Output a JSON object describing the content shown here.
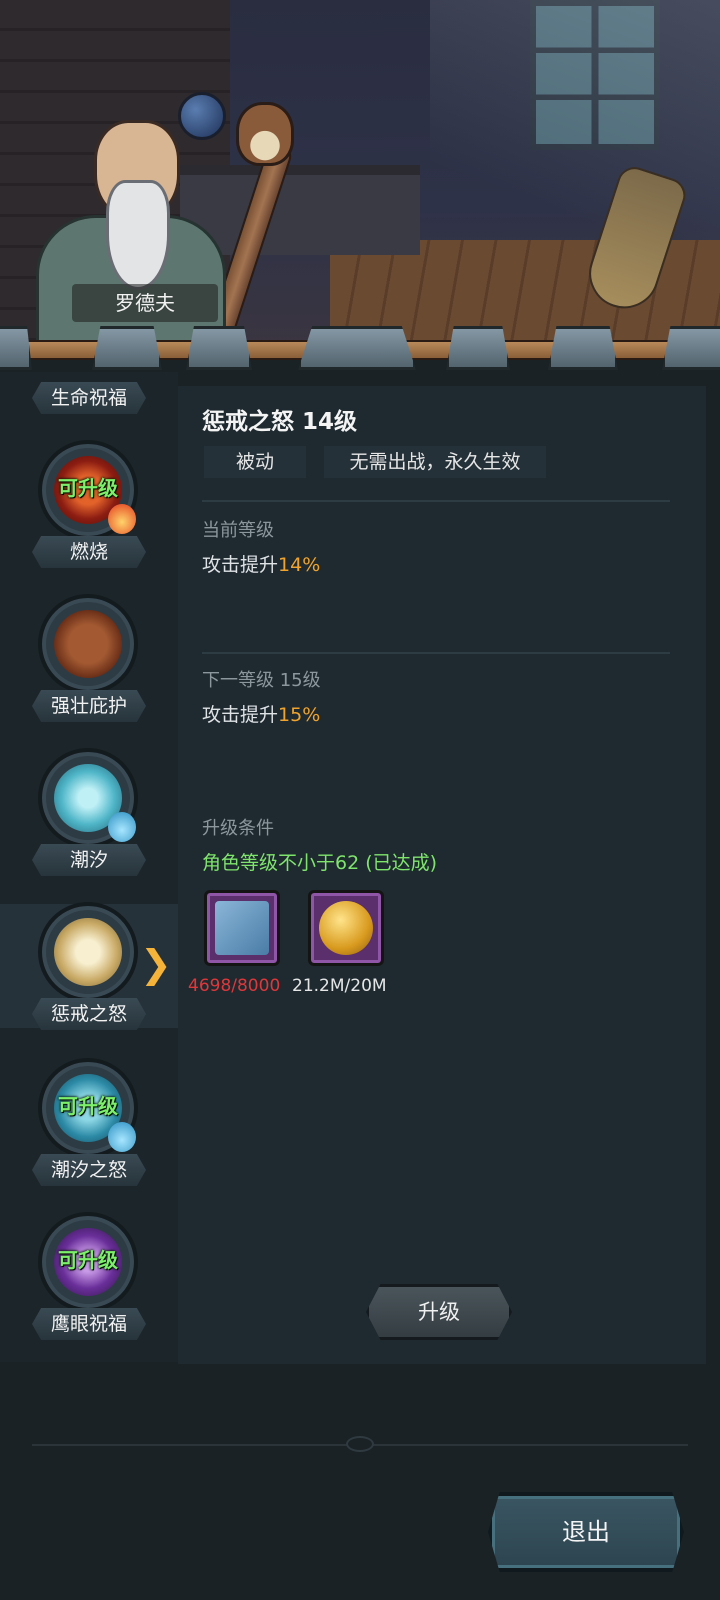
{
  "npc": {
    "name": "罗德夫"
  },
  "sidebar": {
    "items": [
      {
        "label": "生命祝福",
        "upgradable": "",
        "icon": "life-blessing-icon"
      },
      {
        "label": "燃烧",
        "upgradable": "可升级",
        "icon": "burn-icon",
        "element": "fire-element-icon"
      },
      {
        "label": "强壮庇护",
        "upgradable": "",
        "icon": "shield-rock-icon"
      },
      {
        "label": "潮汐",
        "upgradable": "",
        "icon": "ice-crystal-icon",
        "element": "water-element-icon"
      },
      {
        "label": "惩戒之怒",
        "upgradable": "",
        "icon": "punish-hammer-icon",
        "selected": true
      },
      {
        "label": "潮汐之怒",
        "upgradable": "可升级",
        "icon": "tide-wrath-icon",
        "element": "water-element-icon"
      },
      {
        "label": "鹰眼祝福",
        "upgradable": "可升级",
        "icon": "hawk-eye-icon"
      }
    ]
  },
  "detail": {
    "title": "惩戒之怒 14级",
    "tags": [
      "被动",
      "无需出战，永久生效"
    ],
    "current": {
      "label": "当前等级",
      "effect_text": "攻击提升",
      "effect_value": "14%"
    },
    "next": {
      "label": "下一等级 15级",
      "effect_text": "攻击提升",
      "effect_value": "15%"
    },
    "requirement": {
      "label": "升级条件",
      "text": "角色等级不小于62 (已达成)"
    },
    "costs": [
      {
        "icon": "scroll-material-icon",
        "amount": "4698/8000",
        "status": "insufficient"
      },
      {
        "icon": "gold-coin-icon",
        "amount": "21.2M/20M",
        "status": "sufficient"
      }
    ],
    "upgrade_button": "升级"
  },
  "footer": {
    "exit_button": "退出"
  },
  "colors": {
    "highlight": "#f0a42e",
    "requirement_met": "#7fe46c",
    "insufficient": "#e0373a",
    "upgradable": "#7cf06a"
  }
}
